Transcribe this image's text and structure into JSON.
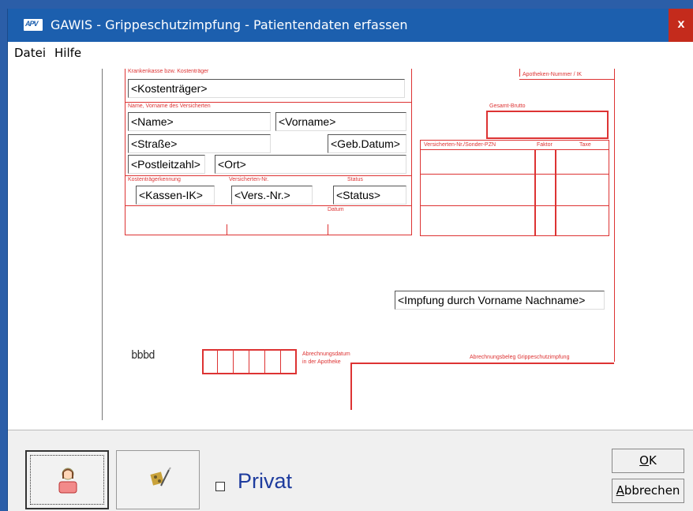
{
  "window": {
    "title": "GAWIS - Grippeschutzimpfung - Patientendaten erfassen",
    "app_icon_text": "APV",
    "close_symbol": "x"
  },
  "menu": {
    "items": [
      "Datei",
      "Hilfe"
    ]
  },
  "form": {
    "labels": {
      "kasse": "Krankenkasse bzw. Kostenträger",
      "name": "Name, Vorname des Versicherten",
      "kennung": "Kostenträgerkennung",
      "versnr": "Versicherten-Nr.",
      "status": "Status",
      "datum": "Datum",
      "apotheken_nr": "Apotheken-Nummer / IK",
      "gesamt_brutto": "Gesamt-Brutto",
      "pzn": "Versicherten-Nr./Sonder-PZN",
      "faktor": "Faktor",
      "taxe": "Taxe",
      "abrechnungsdatum_1": "Abrechnungsdatum",
      "abrechnungsdatum_2": "in der Apotheke",
      "beleg": "Abrechnungsbeleg Grippeschutzimpfung"
    },
    "fields": {
      "kostentraeger": "<Kostenträger>",
      "name": "<Name>",
      "vorname": "<Vorname>",
      "strasse": "<Straße>",
      "geb_datum": "<Geb.Datum>",
      "plz": "<Postleitzahl>",
      "ort": "<Ort>",
      "kassen_ik": "<Kassen-IK>",
      "vers_nr": "<Vers.-Nr.>",
      "status": "<Status>",
      "impfung": "<Impfung durch Vorname Nachname>"
    },
    "counter_text": "bbbd"
  },
  "bottom": {
    "patient_button_icon": "patient-icon",
    "edit_button_icon": "edit-pen-icon",
    "privat_label": "Privat",
    "privat_checked": false,
    "ok_label_prefix": "",
    "ok_label_mnemonic": "O",
    "ok_label_rest": "K",
    "cancel_label_mnemonic": "A",
    "cancel_label_rest": "bbrechen"
  },
  "colors": {
    "titlebar": "#1c5fae",
    "close": "#c42b1c",
    "form_red": "#dd3333",
    "privat": "#1e3c9e"
  }
}
